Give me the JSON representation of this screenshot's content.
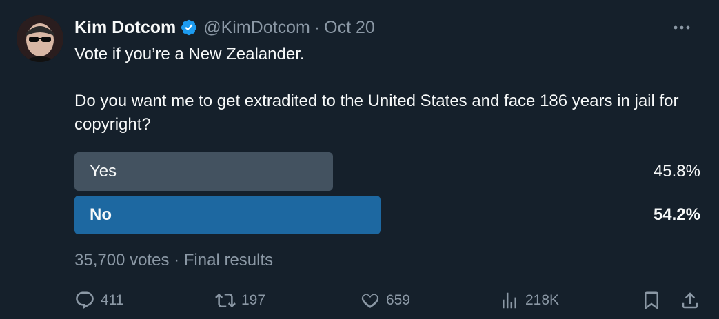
{
  "author": {
    "name": "Kim Dotcom",
    "handle": "@KimDotcom",
    "separator": "·",
    "date": "Oct 20"
  },
  "tweet": {
    "paragraphs": [
      "Vote if you’re a New Zealander.",
      "Do you want me to get extradited to the United States and face 186 years in jail for copyright?"
    ]
  },
  "poll": {
    "options": [
      {
        "label": "Yes",
        "percent": "45.8%",
        "fraction": 0.458,
        "winner": false
      },
      {
        "label": "No",
        "percent": "54.2%",
        "fraction": 0.542,
        "winner": true
      }
    ],
    "summary": "35,700 votes · Final results"
  },
  "actions": {
    "replies": "411",
    "reposts": "197",
    "likes": "659",
    "views": "218K"
  },
  "colors": {
    "background": "#15202b",
    "loser_bar": "#435260",
    "winner_bar": "#1d68a1",
    "verified": "#1d9bf0",
    "muted": "#8b98a5"
  },
  "icons": [
    "verified-badge-icon",
    "more-icon",
    "reply-icon",
    "repost-icon",
    "like-icon",
    "views-icon",
    "bookmark-icon",
    "share-icon"
  ]
}
